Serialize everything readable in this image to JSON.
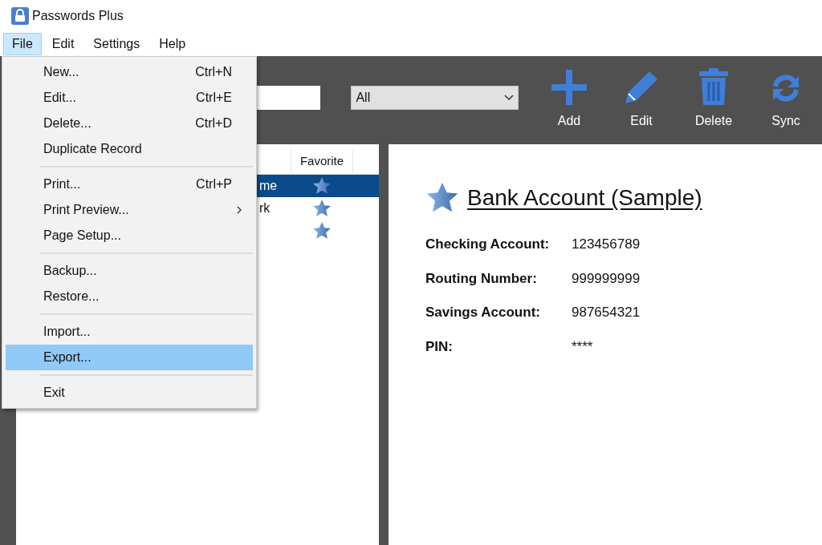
{
  "window": {
    "title": "Passwords Plus"
  },
  "menubar": [
    {
      "label": "File",
      "selected": true
    },
    {
      "label": "Edit",
      "selected": false
    },
    {
      "label": "Settings",
      "selected": false
    },
    {
      "label": "Help",
      "selected": false
    }
  ],
  "file_menu": [
    {
      "kind": "item",
      "label": "New...",
      "shortcut": "Ctrl+N",
      "submenu": false,
      "selected": false
    },
    {
      "kind": "item",
      "label": "Edit...",
      "shortcut": "Ctrl+E",
      "submenu": false,
      "selected": false
    },
    {
      "kind": "item",
      "label": "Delete...",
      "shortcut": "Ctrl+D",
      "submenu": false,
      "selected": false
    },
    {
      "kind": "item",
      "label": "Duplicate Record",
      "submenu": false,
      "selected": false
    },
    {
      "kind": "separator"
    },
    {
      "kind": "item",
      "label": "Print...",
      "shortcut": "Ctrl+P",
      "submenu": false,
      "selected": false
    },
    {
      "kind": "item",
      "label": "Print Preview...",
      "submenu": true,
      "selected": false
    },
    {
      "kind": "item",
      "label": "Page Setup...",
      "submenu": false,
      "selected": false
    },
    {
      "kind": "separator"
    },
    {
      "kind": "item",
      "label": "Backup...",
      "submenu": false,
      "selected": false
    },
    {
      "kind": "item",
      "label": "Restore...",
      "submenu": false,
      "selected": false
    },
    {
      "kind": "separator"
    },
    {
      "kind": "item",
      "label": "Import...",
      "submenu": false,
      "selected": false
    },
    {
      "kind": "item",
      "label": "Export...",
      "submenu": false,
      "selected": true
    },
    {
      "kind": "separator"
    },
    {
      "kind": "item",
      "label": "Exit",
      "submenu": false,
      "selected": false
    }
  ],
  "toolbar": {
    "filter": {
      "value": "All"
    },
    "buttons": [
      {
        "kind": "add",
        "label": "Add"
      },
      {
        "kind": "edit",
        "label": "Edit"
      },
      {
        "kind": "delete",
        "label": "Delete"
      },
      {
        "kind": "sync",
        "label": "Sync"
      }
    ]
  },
  "list": {
    "columns": [
      {
        "label": "Favorite"
      }
    ],
    "rows": [
      {
        "name": "me",
        "favorite": true,
        "selected": true
      },
      {
        "name": "rk",
        "favorite": true,
        "selected": false
      },
      {
        "favorite": true,
        "selected": false
      }
    ]
  },
  "detail": {
    "title": "Bank Account (Sample)",
    "favorite": true,
    "fields": [
      {
        "label": "Checking Account:",
        "value": "123456789"
      },
      {
        "label": "Routing Number:",
        "value": "999999999"
      },
      {
        "label": "Savings Account:",
        "value": "987654321"
      },
      {
        "label": "PIN:",
        "value": "****"
      }
    ]
  }
}
